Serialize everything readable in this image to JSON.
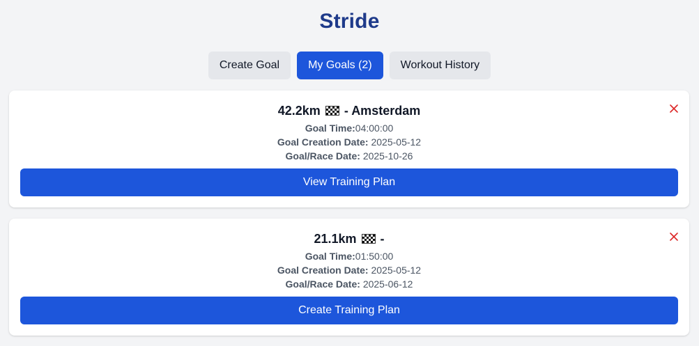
{
  "app": {
    "title": "Stride"
  },
  "tabs": [
    {
      "label": "Create Goal",
      "active": false
    },
    {
      "label": "My Goals (2)",
      "active": true
    },
    {
      "label": "Workout History",
      "active": false
    }
  ],
  "goals": [
    {
      "distance": "42.2km",
      "separator": "-",
      "race_name": "Amsterdam",
      "goal_time_label": "Goal Time:",
      "goal_time": "04:00:00",
      "creation_label": "Goal Creation Date:",
      "creation_date": "2025-05-12",
      "race_date_label": "Goal/Race Date:",
      "race_date": "2025-10-26",
      "action_label": "View Training Plan"
    },
    {
      "distance": "21.1km",
      "separator": "-",
      "race_name": "",
      "goal_time_label": "Goal Time:",
      "goal_time": "01:50:00",
      "creation_label": "Goal Creation Date:",
      "creation_date": "2025-05-12",
      "race_date_label": "Goal/Race Date:",
      "race_date": "2025-06-12",
      "action_label": "Create Training Plan"
    }
  ],
  "colors": {
    "brand": "#1e3a8a",
    "accent": "#1d56db",
    "delete": "#dc2626",
    "background": "#f3f4f6"
  },
  "icons": {
    "flag": "checkered-flag-icon",
    "delete": "close-icon"
  }
}
